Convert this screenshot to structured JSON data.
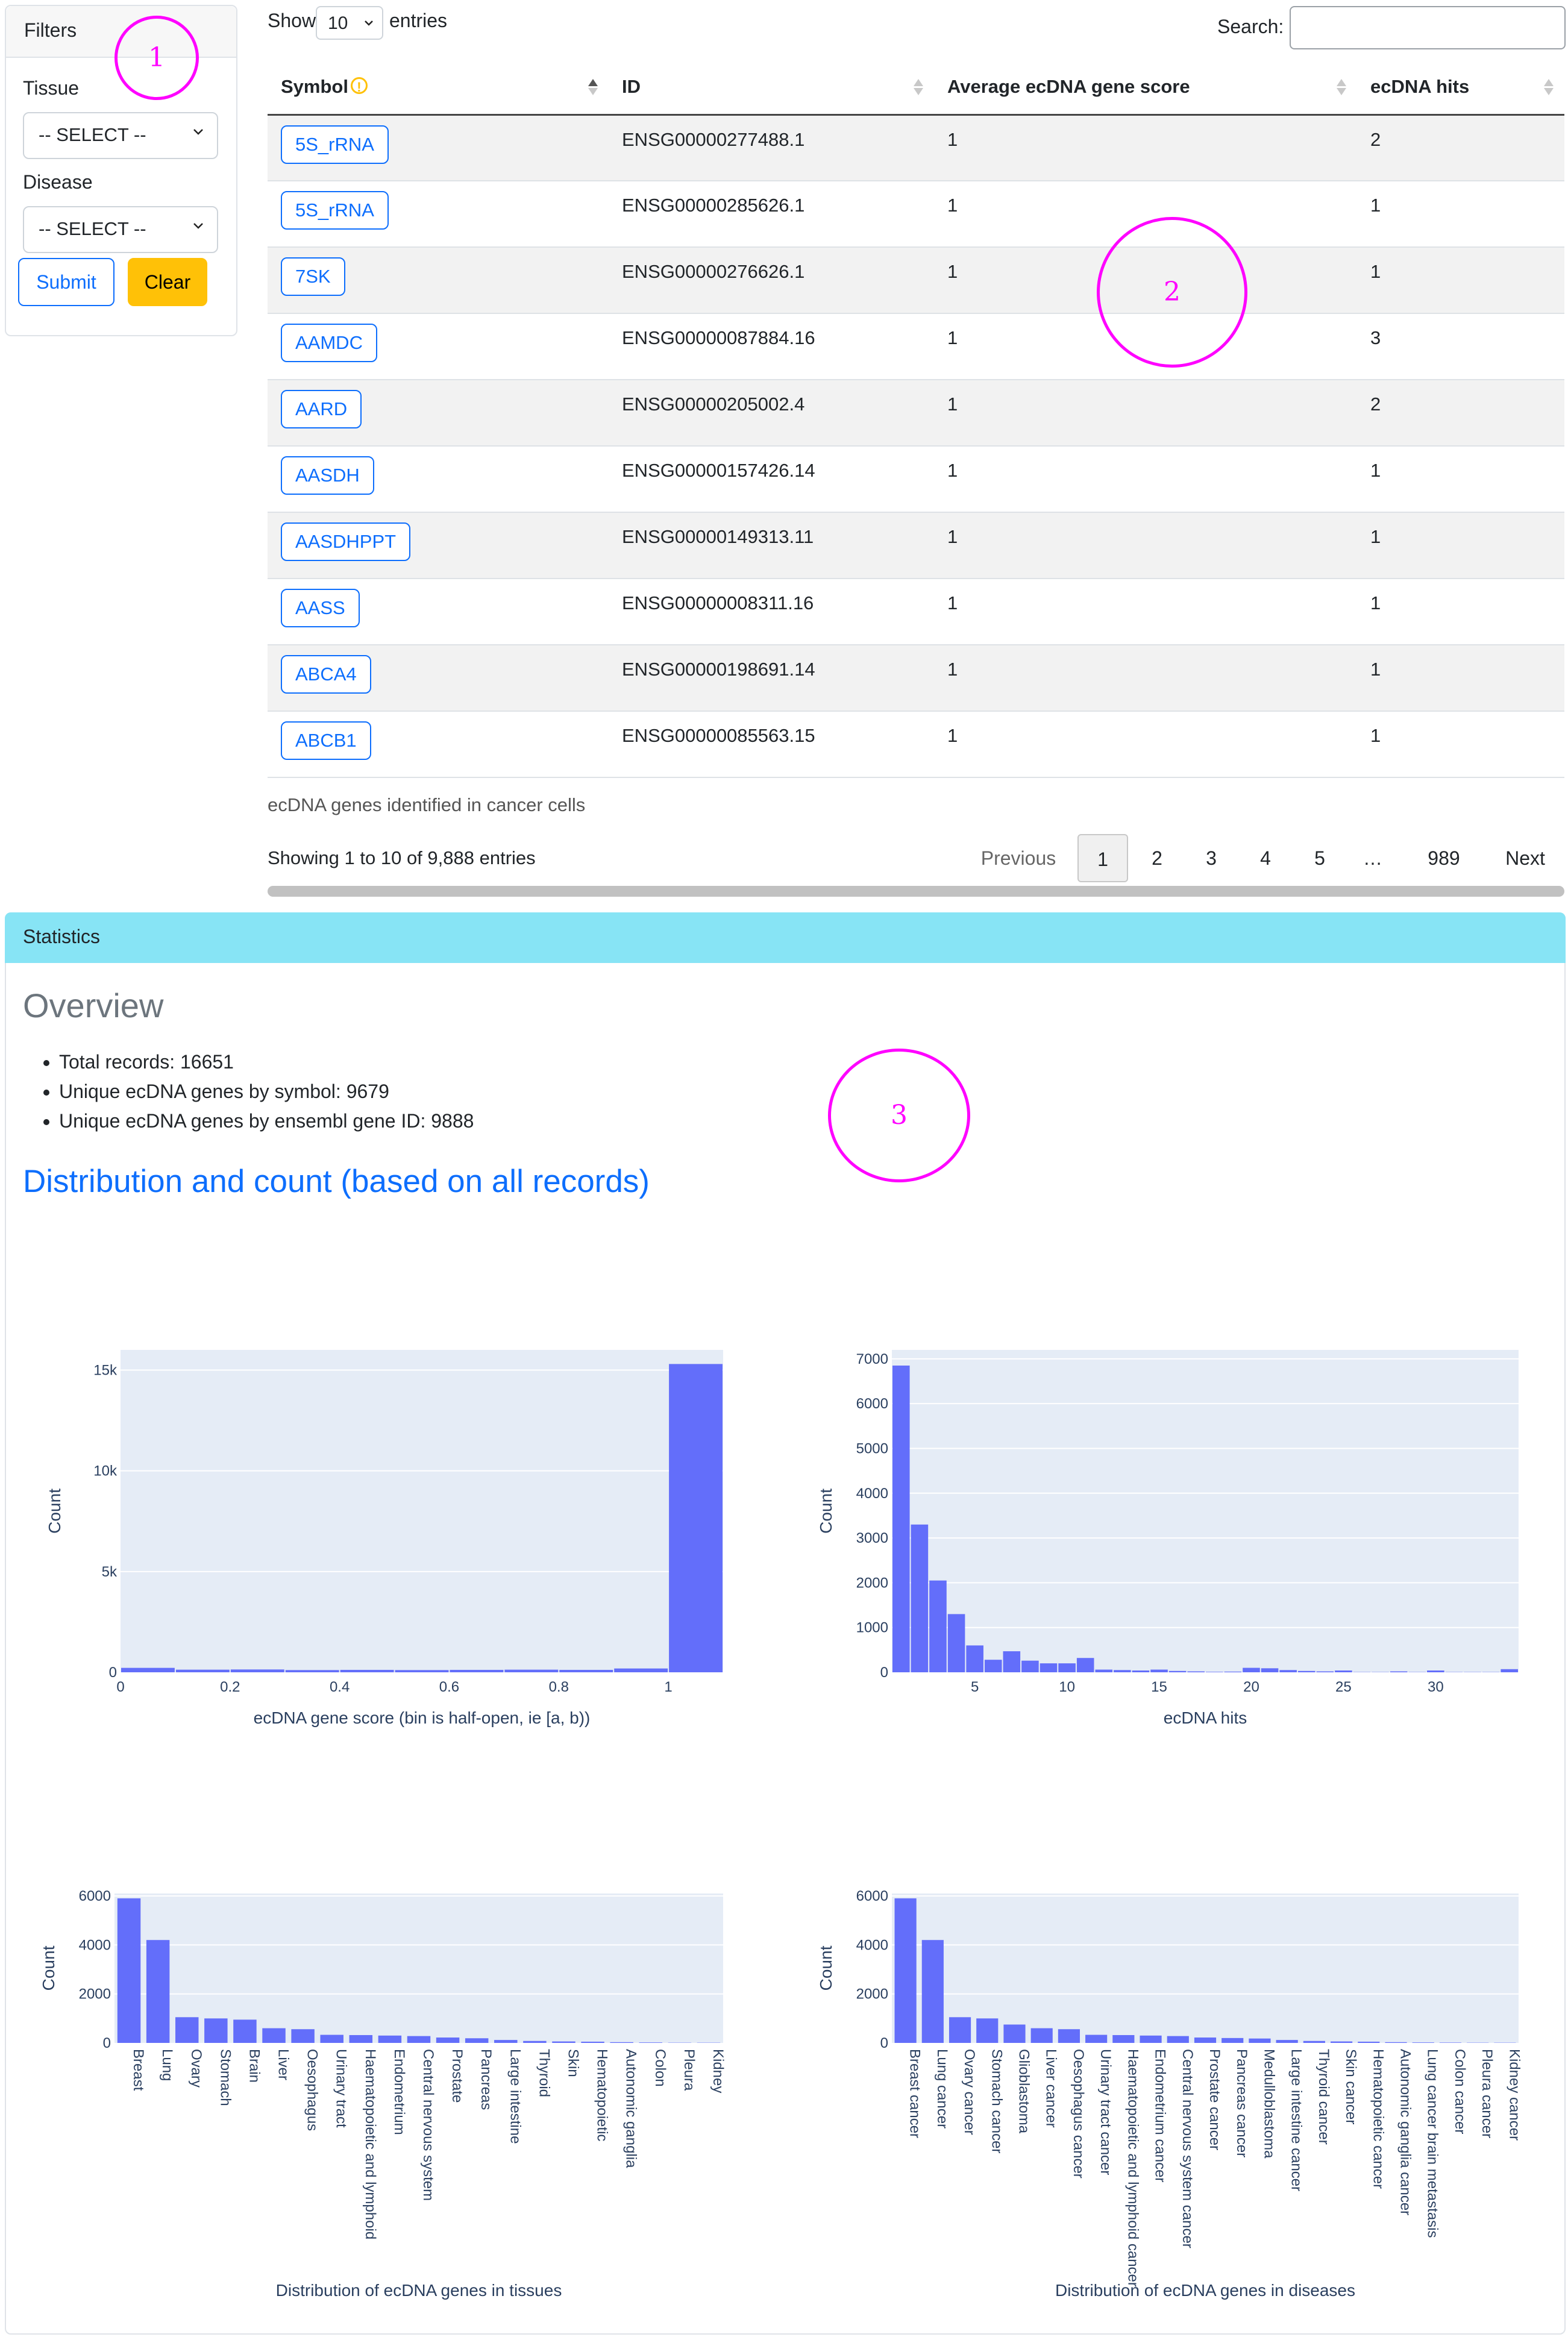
{
  "filters": {
    "header": "Filters",
    "tissue_label": "Tissue",
    "tissue_value": "-- SELECT --",
    "disease_label": "Disease",
    "disease_value": "-- SELECT --",
    "submit_label": "Submit",
    "clear_label": "Clear"
  },
  "table_controls": {
    "show_label": "Show",
    "length_value": "10",
    "entries_label": "entries",
    "search_label": "Search:",
    "search_value": ""
  },
  "table": {
    "columns": [
      "Symbol",
      "ID",
      "Average ecDNA gene score",
      "ecDNA hits"
    ],
    "rows": [
      {
        "symbol": "5S_rRNA",
        "id": "ENSG00000277488.1",
        "score": "1",
        "hits": "2"
      },
      {
        "symbol": "5S_rRNA",
        "id": "ENSG00000285626.1",
        "score": "1",
        "hits": "1"
      },
      {
        "symbol": "7SK",
        "id": "ENSG00000276626.1",
        "score": "1",
        "hits": "1"
      },
      {
        "symbol": "AAMDC",
        "id": "ENSG00000087884.16",
        "score": "1",
        "hits": "3"
      },
      {
        "symbol": "AARD",
        "id": "ENSG00000205002.4",
        "score": "1",
        "hits": "2"
      },
      {
        "symbol": "AASDH",
        "id": "ENSG00000157426.14",
        "score": "1",
        "hits": "1"
      },
      {
        "symbol": "AASDHPPT",
        "id": "ENSG00000149313.11",
        "score": "1",
        "hits": "1"
      },
      {
        "symbol": "AASS",
        "id": "ENSG00000008311.16",
        "score": "1",
        "hits": "1"
      },
      {
        "symbol": "ABCA4",
        "id": "ENSG00000198691.14",
        "score": "1",
        "hits": "1"
      },
      {
        "symbol": "ABCB1",
        "id": "ENSG00000085563.15",
        "score": "1",
        "hits": "1"
      }
    ],
    "caption": "ecDNA genes identified in cancer cells",
    "info": "Showing 1 to 10 of 9,888 entries"
  },
  "pagination": {
    "previous": "Previous",
    "pages": [
      "1",
      "2",
      "3",
      "4",
      "5",
      "…",
      "989"
    ],
    "active": "1",
    "next": "Next"
  },
  "statistics": {
    "header": "Statistics",
    "overview_title": "Overview",
    "items": [
      "Total records: 16651",
      "Unique ecDNA genes by symbol: 9679",
      "Unique ecDNA genes by ensembl gene ID: 9888"
    ],
    "distribution_title": "Distribution and count (based on all records)"
  },
  "annotations": [
    "1",
    "2",
    "3"
  ],
  "colors": {
    "bar": "#636efa",
    "plot_bg": "#e5ecf6",
    "primary": "#0d6efd",
    "warning": "#ffc107",
    "stats_header": "#87e4f5",
    "annotation": "#ff00ff"
  },
  "chart_data": [
    {
      "type": "bar",
      "xlabel": "ecDNA gene score (bin is half-open, ie [a, b))",
      "ylabel": "Count",
      "x": [
        0,
        0.1,
        0.2,
        0.3,
        0.4,
        0.5,
        0.6,
        0.7,
        0.8,
        0.9,
        1.0
      ],
      "values": [
        220,
        130,
        140,
        110,
        120,
        110,
        120,
        130,
        120,
        190,
        15300
      ],
      "bin_width": 0.1,
      "xlim": [
        0,
        1.1
      ],
      "ylim": [
        0,
        16000
      ],
      "xticks": [
        0,
        0.2,
        0.4,
        0.6,
        0.8,
        1
      ],
      "xtick_labels": [
        "0",
        "0.2",
        "0.4",
        "0.6",
        "0.8",
        "1"
      ],
      "yticks": [
        0,
        5000,
        10000,
        15000
      ],
      "ytick_labels": [
        "0",
        "5k",
        "10k",
        "15k"
      ]
    },
    {
      "type": "bar",
      "xlabel": "ecDNA hits",
      "ylabel": "Count",
      "x": [
        1,
        2,
        3,
        4,
        5,
        6,
        7,
        8,
        9,
        10,
        11,
        12,
        13,
        14,
        15,
        16,
        17,
        18,
        19,
        20,
        21,
        22,
        23,
        24,
        25,
        26,
        27,
        28,
        29,
        30,
        31,
        32,
        33,
        34
      ],
      "values": [
        6850,
        3300,
        2050,
        1300,
        600,
        280,
        470,
        260,
        200,
        200,
        320,
        60,
        50,
        40,
        60,
        30,
        20,
        10,
        15,
        100,
        90,
        50,
        30,
        20,
        40,
        5,
        5,
        20,
        5,
        40,
        5,
        5,
        5,
        70
      ],
      "bin_width": 1,
      "xlim": [
        0.5,
        34.5
      ],
      "ylim": [
        0,
        7200
      ],
      "xticks": [
        5,
        10,
        15,
        20,
        25,
        30
      ],
      "xtick_labels": [
        "5",
        "10",
        "15",
        "20",
        "25",
        "30"
      ],
      "yticks": [
        0,
        1000,
        2000,
        3000,
        4000,
        5000,
        6000,
        7000
      ],
      "ytick_labels": [
        "0",
        "1000",
        "2000",
        "3000",
        "4000",
        "5000",
        "6000",
        "7000"
      ]
    },
    {
      "type": "bar",
      "xlabel": "Distribution of ecDNA genes in tissues",
      "ylabel": "Count",
      "categories": [
        "Breast",
        "Lung",
        "Ovary",
        "Stomach",
        "Brain",
        "Liver",
        "Oesophagus",
        "Urinary tract",
        "Haematopoietic and lymphoid",
        "Endometrium",
        "Central nervous system",
        "Prostate",
        "Pancreas",
        "Large intestine",
        "Thyroid",
        "Skin",
        "Hematopoietic",
        "Autonomic ganglia",
        "Colon",
        "Pleura",
        "Kidney"
      ],
      "values": [
        5900,
        4200,
        1050,
        1000,
        950,
        600,
        560,
        330,
        320,
        300,
        280,
        220,
        190,
        120,
        80,
        60,
        50,
        30,
        20,
        10,
        10
      ],
      "ylim": [
        0,
        6100
      ],
      "yticks": [
        0,
        2000,
        4000,
        6000
      ],
      "ytick_labels": [
        "0",
        "2000",
        "4000",
        "6000"
      ]
    },
    {
      "type": "bar",
      "xlabel": "Distribution of ecDNA genes in diseases",
      "ylabel": "Count",
      "categories": [
        "Breast cancer",
        "Lung cancer",
        "Ovary cancer",
        "Stomach cancer",
        "Glioblastoma",
        "Liver cancer",
        "Oesophagus cancer",
        "Urinary tract cancer",
        "Haematopoietic and lymphoid cancer",
        "Endometrium cancer",
        "Central nervous system cancer",
        "Prostate cancer",
        "Pancreas cancer",
        "Medulloblastoma",
        "Large intestine cancer",
        "Thyroid cancer",
        "Skin cancer",
        "Hematopoietic cancer",
        "Autonomic ganglia cancer",
        "Lung cancer brain metastasis",
        "Colon cancer",
        "Pleura cancer",
        "Kidney cancer"
      ],
      "values": [
        5900,
        4200,
        1050,
        1000,
        750,
        600,
        560,
        330,
        320,
        300,
        280,
        220,
        200,
        180,
        120,
        80,
        60,
        50,
        30,
        20,
        15,
        10,
        10
      ],
      "ylim": [
        0,
        6100
      ],
      "yticks": [
        0,
        2000,
        4000,
        6000
      ],
      "ytick_labels": [
        "0",
        "2000",
        "4000",
        "6000"
      ]
    }
  ]
}
